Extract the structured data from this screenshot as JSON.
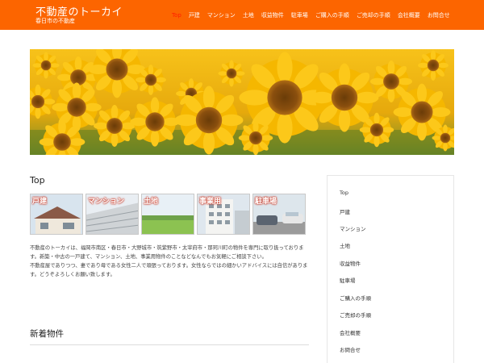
{
  "header": {
    "title": "不動産のトーカイ",
    "subtitle": "春日市の不動産",
    "nav": [
      {
        "label": "Top",
        "active": true
      },
      {
        "label": "戸建"
      },
      {
        "label": "マンション"
      },
      {
        "label": "土地"
      },
      {
        "label": "収益物件"
      },
      {
        "label": "駐車場"
      },
      {
        "label": "ご購入の手順"
      },
      {
        "label": "ご売却の手順"
      },
      {
        "label": "会社概要"
      },
      {
        "label": "お問合せ"
      }
    ]
  },
  "main": {
    "title": "Top",
    "categories": [
      {
        "label": "戸建",
        "icon": "house-photo"
      },
      {
        "label": "マンション",
        "icon": "apartment-photo"
      },
      {
        "label": "土地",
        "icon": "land-photo"
      },
      {
        "label": "事業用",
        "icon": "building-photo"
      },
      {
        "label": "駐車場",
        "icon": "parking-photo"
      }
    ],
    "description": [
      "不動産のトーカイは、福岡市南区・春日市・大野城市・筑紫野市・太宰府市・那珂川町の物件を専門に取り扱っております。新築・中古の一戸建て、マンション、土地、事業用物件のことなどなんでもお気軽にご相談下さい。",
      "不動産屋でありつつ、妻であり母である女性二人で頑張っております。女性ならではの細かいアドバイスには自信があります。どうぞよろしくお願い致します。"
    ],
    "news_title": "新着物件"
  },
  "sidebar": {
    "items": [
      "Top",
      "戸建",
      "マンション",
      "土地",
      "収益物件",
      "駐車場",
      "ご購入の手順",
      "ご売却の手順",
      "会社概要",
      "お問合せ"
    ]
  },
  "colors": {
    "header_bg": "#fc6500",
    "nav_active": "#ff1e00",
    "category_label_outline": "#c8321e"
  }
}
